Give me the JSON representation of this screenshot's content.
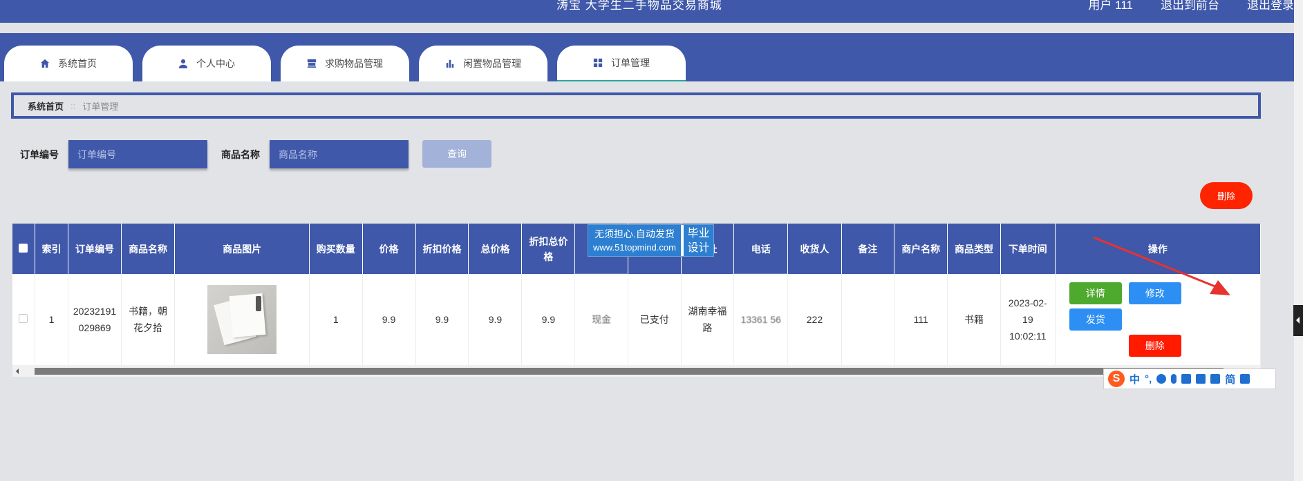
{
  "header": {
    "site_title": "涛宝   大学生二手物品交易商城",
    "user_label": "用户 111",
    "back_front": "退出到前台",
    "logout": "退出登录"
  },
  "tabs": [
    {
      "label": "系统首页",
      "icon": "home-icon"
    },
    {
      "label": "个人中心",
      "icon": "user-icon"
    },
    {
      "label": "求购物品管理",
      "icon": "shop-icon"
    },
    {
      "label": "闲置物品管理",
      "icon": "bar-chart-icon"
    },
    {
      "label": "订单管理",
      "icon": "grid-icon",
      "active": true
    }
  ],
  "breadcrumb": {
    "home": "系统首页",
    "separator": "::",
    "current": "订单管理"
  },
  "search": {
    "order_no_label": "订单编号",
    "order_no_placeholder": "订单编号",
    "product_name_label": "商品名称",
    "product_name_placeholder": "商品名称",
    "query_button": "查询"
  },
  "batch_delete_button": "删除",
  "table": {
    "columns": [
      "索引",
      "订单编号",
      "商品名称",
      "商品图片",
      "购买数量",
      "价格",
      "折扣价格",
      "总价格",
      "折扣总价格",
      "",
      "",
      "地址",
      "电话",
      "收货人",
      "备注",
      "商户名称",
      "商品类型",
      "下单时间",
      "操作"
    ],
    "rows": [
      {
        "index": "1",
        "order_no": "20232191029869",
        "product_name": "书籍，朝花夕拾",
        "quantity": "1",
        "price": "9.9",
        "discount_price": "9.9",
        "total_price": "9.9",
        "discount_total": "9.9",
        "pay_method": "现金",
        "status": "已支付",
        "address": "湖南幸福路",
        "phone": "13361 56",
        "receiver": "222",
        "remark": "",
        "merchant": "111",
        "category": "书籍",
        "order_time": "2023-02-19 10:02:11",
        "actions": {
          "detail": "详情",
          "edit": "修改",
          "ship": "发货",
          "delete": "删除"
        }
      }
    ]
  },
  "watermark": {
    "line1": "无须担心.自动发货",
    "line2": "www.51topmind.com",
    "right1": "毕业",
    "right2": "设计"
  },
  "ime": {
    "mode": "中",
    "punct": "°,",
    "simplified": "简"
  },
  "colors": {
    "primary": "#3f58a9",
    "danger": "#ff2400",
    "success": "#4eaa2e",
    "info": "#2d8ff3",
    "arrow": "#e8322e"
  }
}
